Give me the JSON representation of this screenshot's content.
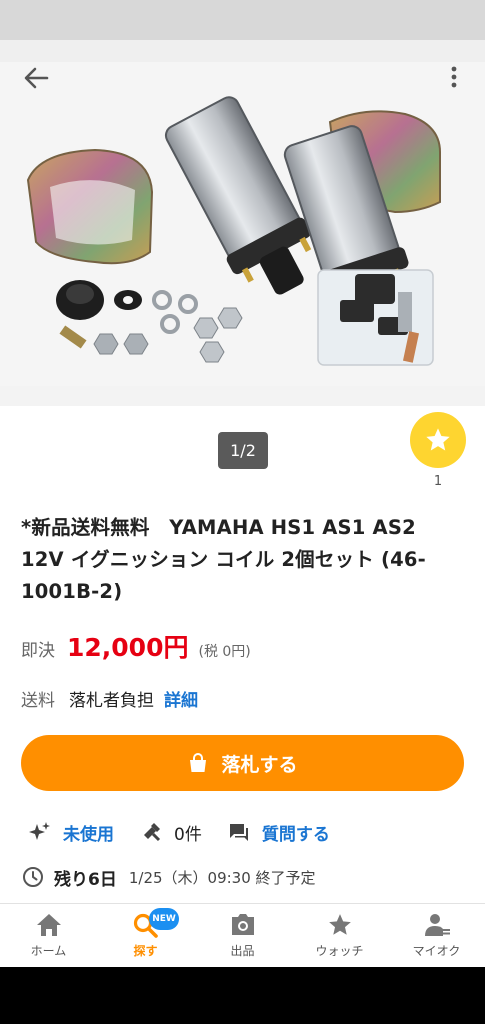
{
  "header": {
    "back_icon": "arrow-left-icon",
    "more_icon": "more-vertical-icon"
  },
  "gallery": {
    "pager": "1/2"
  },
  "watch": {
    "icon": "star-icon",
    "count": "1"
  },
  "item": {
    "title": "*新品送料無料　YAMAHA HS1 AS1 AS2 12V イグニッション コイル 2個セット (46-1001B-2)",
    "price_label": "即決",
    "price_value": "12,000円",
    "price_tax": "(税 0円)",
    "shipping_label": "送料",
    "shipping_value": "落札者負担",
    "shipping_link": "詳細"
  },
  "bid_button": {
    "label": "落札する",
    "icon": "shopping-bag-icon"
  },
  "meta": {
    "condition": "未使用",
    "bids": "0件",
    "question": "質問する"
  },
  "ending": {
    "remaining": "残り6日",
    "date": "1/25（木）09:30 終了予定"
  },
  "tabbar": {
    "tabs": [
      {
        "label": "ホーム",
        "icon": "home-icon"
      },
      {
        "label": "探す",
        "icon": "search-icon",
        "badge": "NEW"
      },
      {
        "label": "出品",
        "icon": "camera-icon"
      },
      {
        "label": "ウォッチ",
        "icon": "star-icon"
      },
      {
        "label": "マイオク",
        "icon": "person-list-icon"
      }
    ]
  },
  "colors": {
    "accent_orange": "#ff8f00",
    "price_red": "#e60012",
    "link_blue": "#1a75d2",
    "watch_yellow": "#fed530"
  }
}
